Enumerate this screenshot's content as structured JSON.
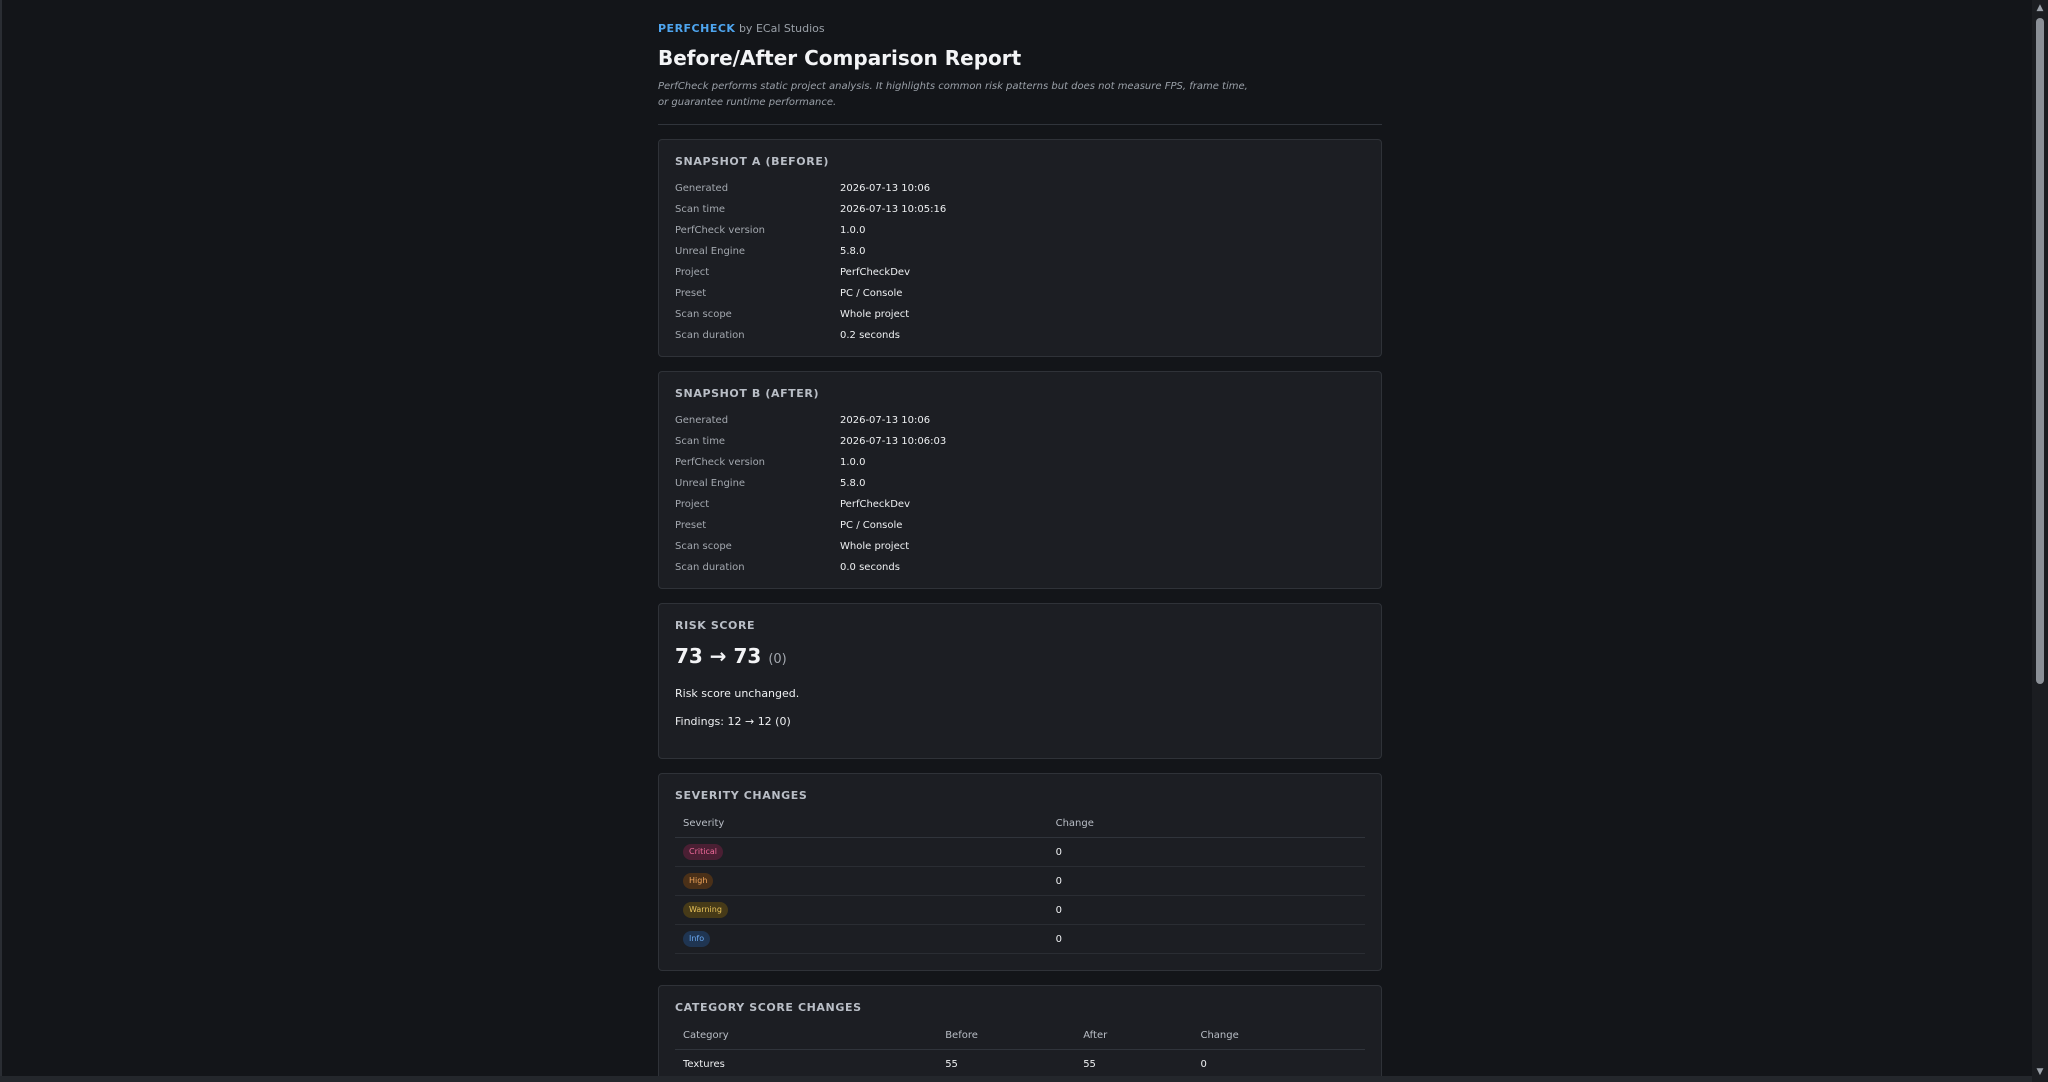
{
  "header": {
    "brand": "PERFCHECK",
    "byline": "by ECal Studios",
    "title": "Before/After Comparison Report",
    "disclaimer": "PerfCheck performs static project analysis. It highlights common risk patterns but does not measure FPS, frame time, or guarantee runtime performance."
  },
  "snapshots": [
    {
      "title": "SNAPSHOT A (BEFORE)",
      "rows": [
        {
          "label": "Generated",
          "value": "2026-07-13 10:06"
        },
        {
          "label": "Scan time",
          "value": "2026-07-13 10:05:16"
        },
        {
          "label": "PerfCheck version",
          "value": "1.0.0"
        },
        {
          "label": "Unreal Engine",
          "value": "5.8.0"
        },
        {
          "label": "Project",
          "value": "PerfCheckDev"
        },
        {
          "label": "Preset",
          "value": "PC / Console"
        },
        {
          "label": "Scan scope",
          "value": "Whole project"
        },
        {
          "label": "Scan duration",
          "value": "0.2 seconds"
        }
      ]
    },
    {
      "title": "SNAPSHOT B (AFTER)",
      "rows": [
        {
          "label": "Generated",
          "value": "2026-07-13 10:06"
        },
        {
          "label": "Scan time",
          "value": "2026-07-13 10:06:03"
        },
        {
          "label": "PerfCheck version",
          "value": "1.0.0"
        },
        {
          "label": "Unreal Engine",
          "value": "5.8.0"
        },
        {
          "label": "Project",
          "value": "PerfCheckDev"
        },
        {
          "label": "Preset",
          "value": "PC / Console"
        },
        {
          "label": "Scan scope",
          "value": "Whole project"
        },
        {
          "label": "Scan duration",
          "value": "0.0 seconds"
        }
      ]
    }
  ],
  "risk": {
    "title": "RISK SCORE",
    "score": "73 → 73",
    "delta": "(0)",
    "summary": "Risk score unchanged.",
    "findings": "Findings: 12 → 12 (0)"
  },
  "severity": {
    "title": "SEVERITY CHANGES",
    "headers": [
      "Severity",
      "Change"
    ],
    "rows": [
      {
        "label": "Critical",
        "change": "0",
        "fg": "#f06a9a",
        "bg": "#4a1f33"
      },
      {
        "label": "High",
        "change": "0",
        "fg": "#f2a55a",
        "bg": "#4a3018"
      },
      {
        "label": "Warning",
        "change": "0",
        "fg": "#e9c35a",
        "bg": "#463a18"
      },
      {
        "label": "Info",
        "change": "0",
        "fg": "#6aa8f0",
        "bg": "#1f3552"
      }
    ]
  },
  "category": {
    "title": "CATEGORY SCORE CHANGES",
    "headers": [
      "Category",
      "Before",
      "After",
      "Change"
    ],
    "rows": [
      {
        "category": "Textures",
        "before": "55",
        "after": "55",
        "change": "0"
      }
    ]
  }
}
